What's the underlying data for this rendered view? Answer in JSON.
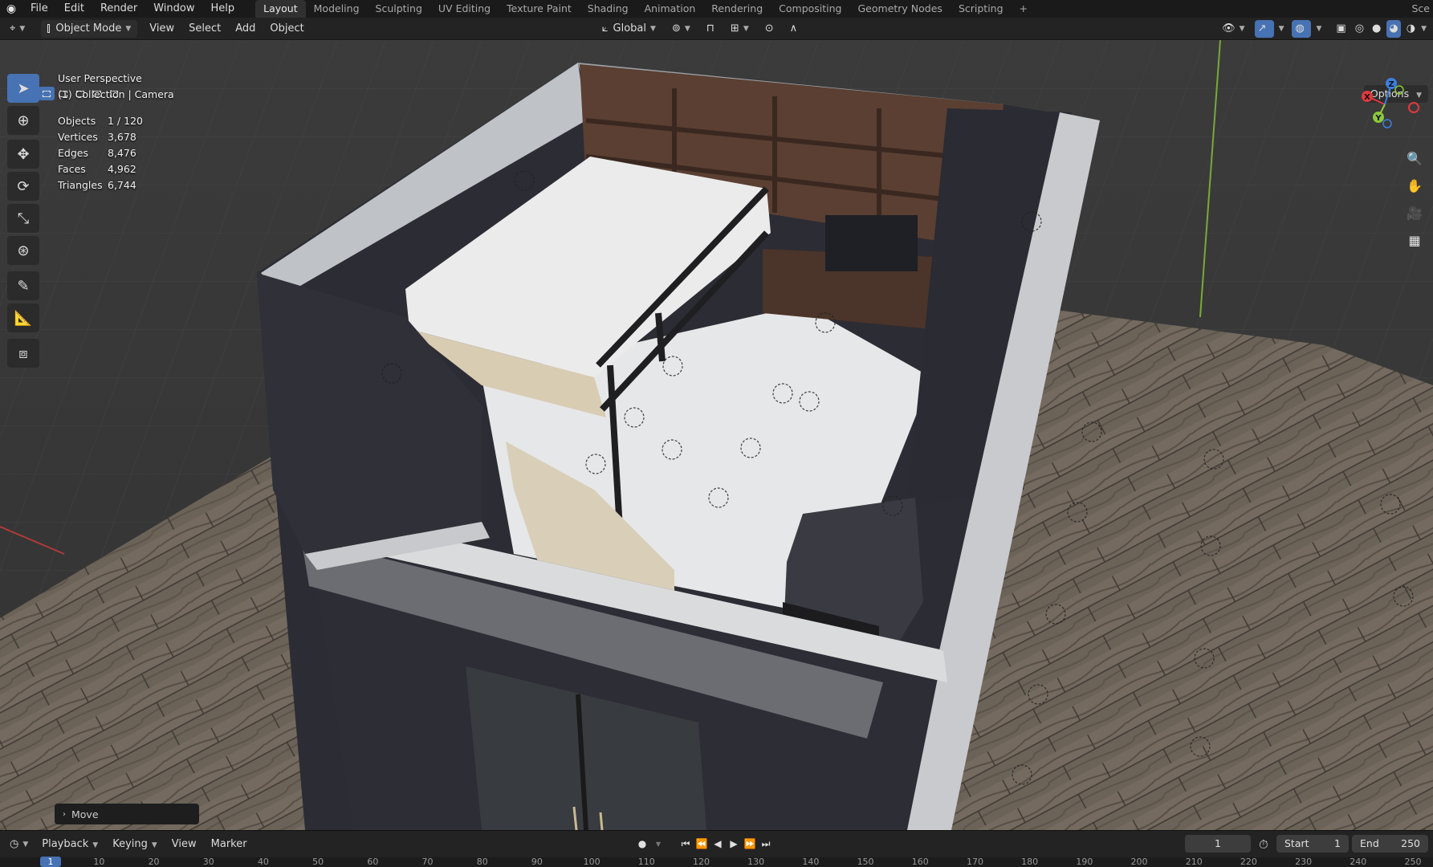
{
  "top_menu": {
    "items": [
      "File",
      "Edit",
      "Render",
      "Window",
      "Help"
    ],
    "workspaces": [
      "Layout",
      "Modeling",
      "Sculpting",
      "UV Editing",
      "Texture Paint",
      "Shading",
      "Animation",
      "Rendering",
      "Compositing",
      "Geometry Nodes",
      "Scripting"
    ],
    "active_workspace": "Layout",
    "add_tab": "+",
    "scene_label": "Sce"
  },
  "header": {
    "mode": "Object Mode",
    "menus": [
      "View",
      "Select",
      "Add",
      "Object"
    ],
    "transform_orientation": "Global"
  },
  "viewport": {
    "perspective": "User Perspective",
    "collection": "(1) Collection | Camera",
    "stats": [
      {
        "label": "Objects",
        "value": "1 / 120"
      },
      {
        "label": "Vertices",
        "value": "3,678"
      },
      {
        "label": "Edges",
        "value": "8,476"
      },
      {
        "label": "Faces",
        "value": "4,962"
      },
      {
        "label": "Triangles",
        "value": "6,744"
      }
    ],
    "options_label": "Options",
    "last_operator": "Move",
    "gizmo_axes": {
      "x": "X",
      "y": "Y",
      "z": "Z"
    }
  },
  "timeline": {
    "menus": [
      "Playback",
      "Keying",
      "View",
      "Marker"
    ],
    "current_frame": "1",
    "start_label": "Start",
    "start_value": "1",
    "end_label": "End",
    "end_value": "250",
    "ruler_marks": [
      "1",
      "10",
      "20",
      "30",
      "40",
      "50",
      "60",
      "70",
      "80",
      "90",
      "100",
      "110",
      "120",
      "130",
      "140",
      "150",
      "160",
      "170",
      "180",
      "190",
      "200",
      "210",
      "220",
      "230",
      "240",
      "250"
    ]
  },
  "colors": {
    "accent": "#4772b3",
    "x_axis": "#e0393e",
    "y_axis": "#8cc83a",
    "z_axis": "#3c7fe0"
  }
}
